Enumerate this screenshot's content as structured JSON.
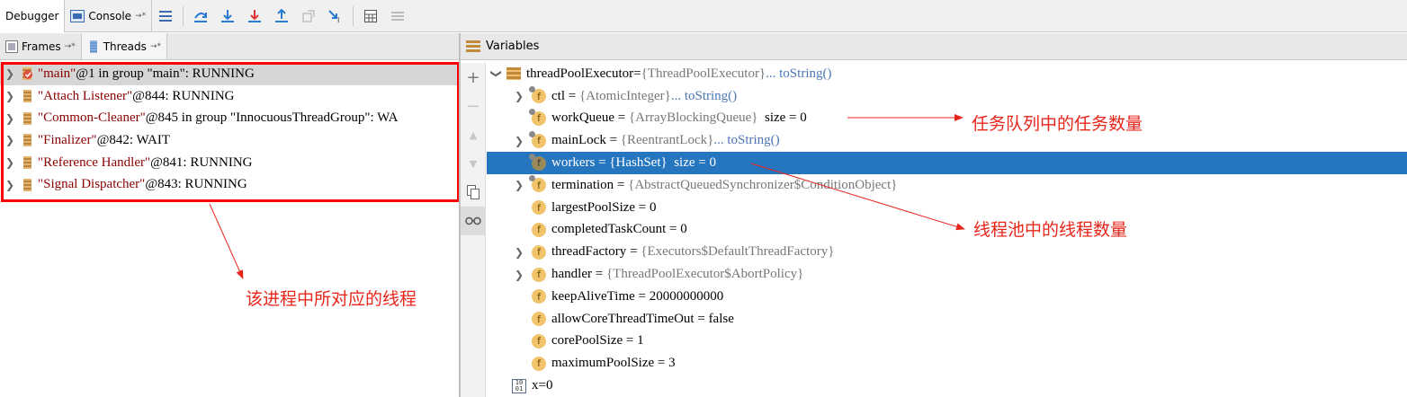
{
  "toolbar": {
    "debugger_tab": "Debugger",
    "console_tab": "Console",
    "buttons": [
      "show-execution-point-icon",
      "step-over-icon",
      "step-into-icon",
      "force-step-into-icon",
      "step-out-icon",
      "drop-frame-icon",
      "run-to-cursor-icon",
      "evaluate-expression-icon",
      "trace-icon"
    ]
  },
  "left_panel": {
    "frames_tab": "Frames",
    "threads_tab": "Threads",
    "threads": [
      {
        "name": "\"main\"",
        "detail": "@1 in group \"main\": RUNNING",
        "selected": true
      },
      {
        "name": "\"Attach Listener\"",
        "detail": "@844: RUNNING"
      },
      {
        "name": "\"Common-Cleaner\"",
        "detail": "@845 in group \"InnocuousThreadGroup\": WA"
      },
      {
        "name": "\"Finalizer\"",
        "detail": "@842: WAIT"
      },
      {
        "name": "\"Reference Handler\"",
        "detail": "@841: RUNNING"
      },
      {
        "name": "\"Signal Dispatcher\"",
        "detail": "@843: RUNNING"
      }
    ]
  },
  "right_panel": {
    "title": "Variables",
    "root": {
      "name": "threadPoolExecutor",
      "eq": " = ",
      "type": "{ThreadPoolExecutor}",
      "link": " ... toString()"
    },
    "fields": [
      {
        "name": "ctl",
        "type": "{AtomicInteger}",
        "link": " ... toString()",
        "expandable": true,
        "locked": true
      },
      {
        "name": "workQueue",
        "type": "{ArrayBlockingQueue}",
        "extra": "  size = 0",
        "locked": true
      },
      {
        "name": "mainLock",
        "type": "{ReentrantLock}",
        "link": " ... toString()",
        "expandable": true,
        "locked": true
      },
      {
        "name": "workers",
        "type": "{HashSet}",
        "extra": "  size = 0",
        "selected": true,
        "locked": true
      },
      {
        "name": "termination",
        "type": "{AbstractQueuedSynchronizer$ConditionObject}",
        "expandable": true,
        "locked": true
      },
      {
        "name": "largestPoolSize",
        "value": "0"
      },
      {
        "name": "completedTaskCount",
        "value": "0"
      },
      {
        "name": "threadFactory",
        "type": "{Executors$DefaultThreadFactory}",
        "expandable": true
      },
      {
        "name": "handler",
        "type": "{ThreadPoolExecutor$AbortPolicy}",
        "expandable": true
      },
      {
        "name": "keepAliveTime",
        "value": "20000000000"
      },
      {
        "name": "allowCoreThreadTimeOut",
        "value": "false"
      },
      {
        "name": "corePoolSize",
        "value": "1"
      },
      {
        "name": "maximumPoolSize",
        "value": "3"
      }
    ],
    "local": {
      "name": "x",
      "value": "0"
    }
  },
  "annotations": {
    "queue_note": "任务队列中的任务数量",
    "workers_note": "线程池中的线程数量",
    "threads_note": "该进程中所对应的线程"
  },
  "colors": {
    "selection": "#2675bf",
    "annotation": "#e8251b",
    "highlight_box": "#ff0000"
  }
}
